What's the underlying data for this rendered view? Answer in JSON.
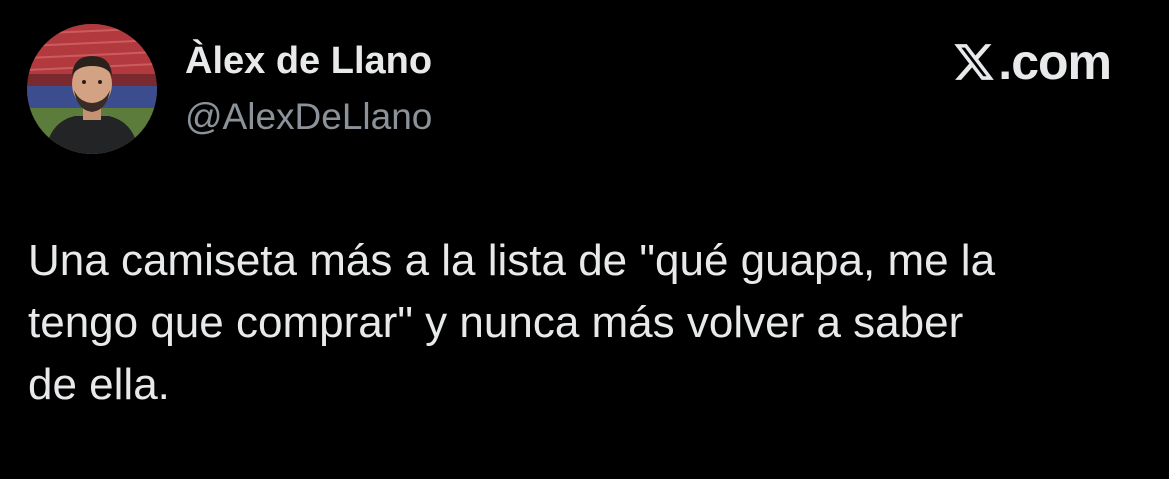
{
  "author": {
    "display_name": "Àlex de Llano",
    "handle": "@AlexDeLlano",
    "avatar_icon": "profile-photo"
  },
  "brand": {
    "logo_icon": "x-logo-icon",
    "domain": ".com"
  },
  "tweet": {
    "lines": [
      "Una camiseta más a la lista de \"qué guapa, me la",
      "tengo que comprar\" y nunca más volver a saber",
      "de ella."
    ]
  },
  "colors": {
    "background": "#000000",
    "primary_text": "#e7e9ea",
    "secondary_text": "#8b9299"
  }
}
